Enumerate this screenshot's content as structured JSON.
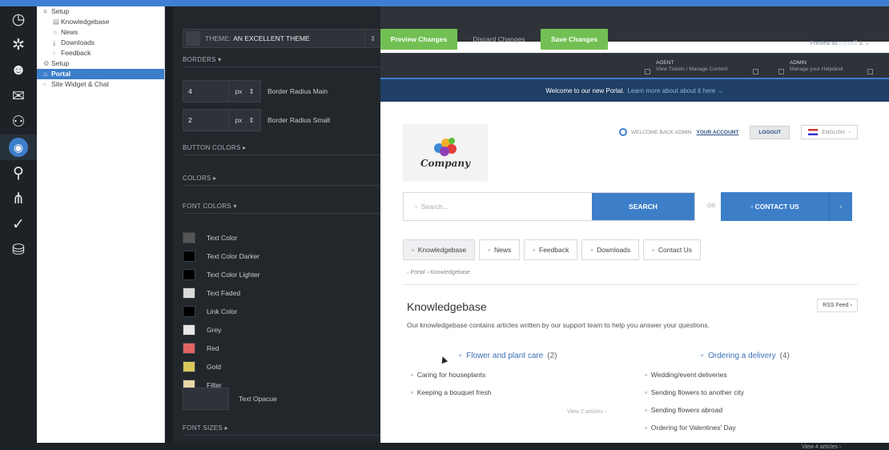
{
  "nav_tree": {
    "items": [
      {
        "icon": "≡",
        "label": "Setup",
        "indent": 8
      },
      {
        "icon": "▤",
        "label": "Knowledgebase",
        "indent": 20
      },
      {
        "icon": "○",
        "label": "News",
        "indent": 20
      },
      {
        "icon": "⤓",
        "label": "Downloads",
        "indent": 20
      },
      {
        "icon": "▫",
        "label": "Feedback",
        "indent": 20
      },
      {
        "icon": "⚙",
        "label": "Setup",
        "indent": 8
      },
      {
        "icon": "⌂",
        "label": "Portal",
        "indent": 8,
        "selected": true
      },
      {
        "icon": "▫",
        "label": "Site Widget & Chat",
        "indent": 8
      }
    ]
  },
  "editor": {
    "theme_label": "THEME:",
    "theme_value": "AN EXCELLENT THEME",
    "sections": {
      "borders": "BORDERS ▾",
      "button_colors": "BUTTON COLORS ▸",
      "colors": "COLORS ▸",
      "font_colors": "FONT COLORS ▾",
      "font_sizes": "FONT SIZES ▸"
    },
    "radius_main": {
      "value": "4",
      "unit": "px",
      "label": "Border Radius Main"
    },
    "radius_small": {
      "value": "2",
      "unit": "px",
      "label": "Border Radius Small"
    },
    "font_colors": [
      {
        "label": "Text Color",
        "color": "#555555"
      },
      {
        "label": "Text Color Darker",
        "color": "#000000"
      },
      {
        "label": "Text Color Lighter",
        "color": "#000000"
      },
      {
        "label": "Text Faded",
        "color": "#d9d9d9"
      },
      {
        "label": "Link Color",
        "color": "#000000"
      },
      {
        "label": "Grey",
        "color": "#e6e6e6"
      },
      {
        "label": "Red",
        "color": "#e06464"
      },
      {
        "label": "Gold",
        "color": "#d9c85a"
      },
      {
        "label": "Filter",
        "color": "#e8d7a6"
      }
    ],
    "text_opaque_label": "Text Opacue"
  },
  "preview": {
    "preview_changes": "Preview Changes",
    "discard_changes": "Discard Changes",
    "save_changes": "Save Changes",
    "preview_as_label": "Preview as",
    "preview_as_user": "myself",
    "agent": {
      "title": "AGENT",
      "sub": "View Tickets / Manage Content"
    },
    "admin": {
      "title": "ADMIN",
      "sub": "Manage your Helpdesk"
    },
    "welcome_text": "Welcome to our new Portal.",
    "welcome_link": "Learn more about about it here →"
  },
  "portal": {
    "logo_text": "Company",
    "welcome_back": "WELCOME BACK ADMIN",
    "your_account": "YOUR ACCOUNT",
    "logout": "LOGOUT",
    "language": "ENGLISH",
    "search_placeholder": "Search...",
    "search_button": "SEARCH",
    "or": "OR",
    "contact_us": "CONTACT US",
    "tabs": [
      "Knowledgebase",
      "News",
      "Feedback",
      "Downloads",
      "Contact Us"
    ],
    "breadcrumb_root": "Portal",
    "breadcrumb_current": "Knowledgebase",
    "kb_title": "Knowledgebase",
    "rss": "RSS Feed",
    "kb_desc": "Our knowledgebase contains articles written by our support team to help you answer your questions.",
    "categories": [
      {
        "name": "Flower and plant care",
        "count": "(2)",
        "articles": [
          "Caring for houseplants",
          "Keeping a bouquet fresh"
        ],
        "view": "View 2 articles"
      },
      {
        "name": "Ordering a delivery",
        "count": "(4)",
        "articles": [
          "Wedding/event deliveries",
          "Sending flowers to another city",
          "Sending flowers abroad",
          "Ordering for Valentines' Day"
        ],
        "view": "View 4 articles"
      }
    ]
  }
}
